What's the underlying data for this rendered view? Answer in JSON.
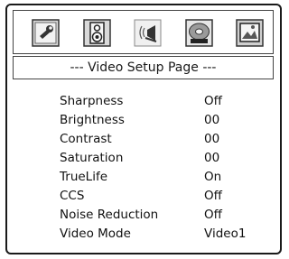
{
  "menu": {
    "tabs": [
      {
        "name": "general-setup",
        "icon": "wrench-icon"
      },
      {
        "name": "speaker-setup",
        "icon": "speaker-icon"
      },
      {
        "name": "audio-setup",
        "icon": "sound-icon"
      },
      {
        "name": "video-setup",
        "icon": "video-disc-icon",
        "selected": true
      },
      {
        "name": "preference",
        "icon": "picture-icon"
      }
    ],
    "page_title": "--- Video Setup Page ---"
  },
  "settings": [
    {
      "label": "Sharpness",
      "value": "Off"
    },
    {
      "label": "Brightness",
      "value": "00"
    },
    {
      "label": "Contrast",
      "value": "00"
    },
    {
      "label": "Saturation",
      "value": "00"
    },
    {
      "label": "TrueLife",
      "value": "On"
    },
    {
      "label": "CCS",
      "value": "Off"
    },
    {
      "label": "Noise Reduction",
      "value": "Off"
    },
    {
      "label": "Video Mode",
      "value": "Video1"
    }
  ]
}
